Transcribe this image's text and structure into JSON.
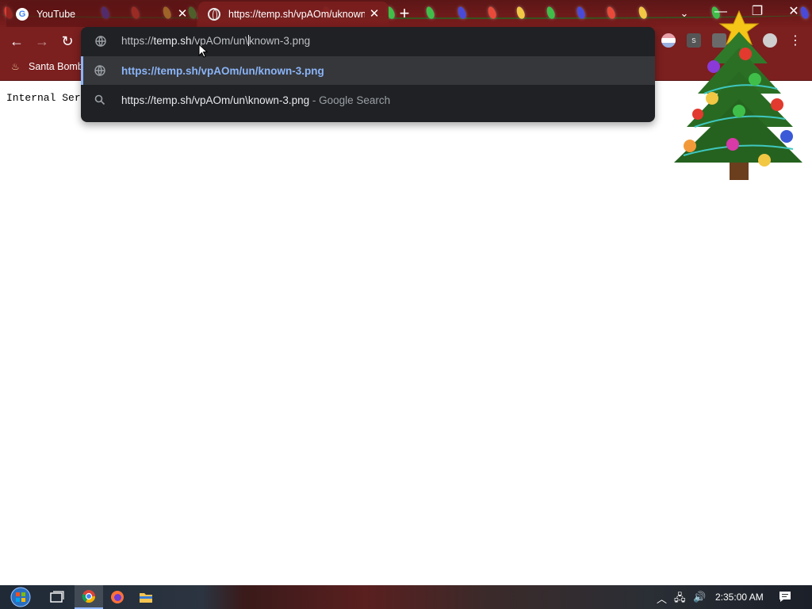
{
  "browser": {
    "tabs": [
      {
        "title": "YouTube",
        "active": false,
        "favicon": "google-icon"
      },
      {
        "title": "https://temp.sh/vpAOm/uknown",
        "active": true,
        "favicon": "globe-icon"
      }
    ],
    "bookmarks": [
      {
        "label": "Santa Bomb",
        "icon": "candle-icon"
      }
    ]
  },
  "omnibox": {
    "input": {
      "prefix": "https://",
      "host": "temp.sh",
      "path_before_caret": "/vpAOm/un\\",
      "path_after_caret": "known-3.png"
    },
    "suggestions": [
      {
        "text": "https://temp.sh/vpAOm/un/known-3.png",
        "suffix": "",
        "icon": "globe-icon",
        "selected": true
      },
      {
        "text": "https://temp.sh/vpAOm/un\\known-3.png",
        "suffix": " - Google Search",
        "icon": "search-icon",
        "selected": false
      }
    ]
  },
  "page": {
    "body_text": "Internal Serv"
  },
  "taskbar": {
    "apps": [
      "start-button",
      "task-view-icon",
      "chrome-icon",
      "firefox-icon",
      "file-explorer-icon"
    ],
    "clock": "2:35:00 AM"
  },
  "colors": {
    "tab_strip": "#5c1616",
    "toolbar": "#7b1f1f",
    "omnibox_bg": "#202124",
    "suggestion_link": "#8ab4f8"
  }
}
